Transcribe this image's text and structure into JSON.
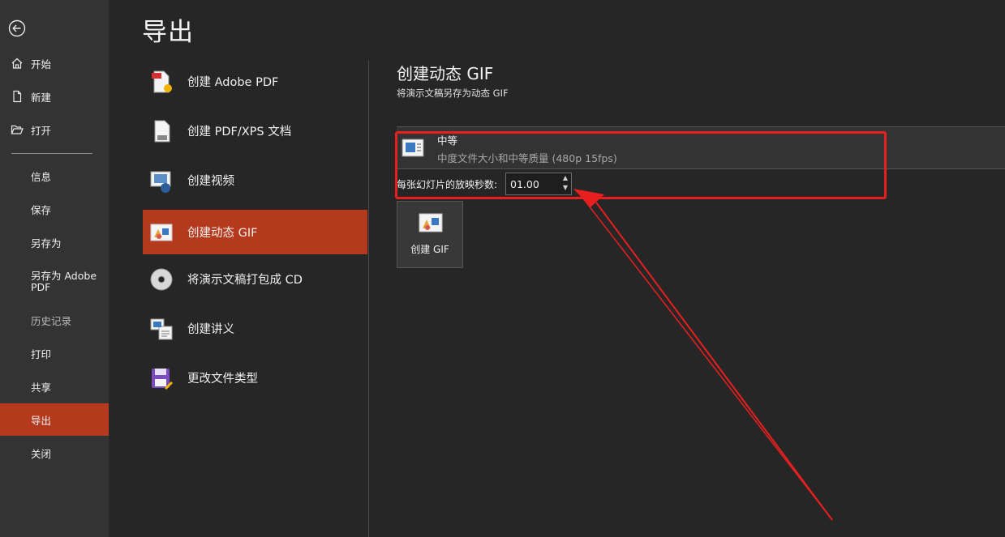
{
  "sidebar": {
    "items": [
      {
        "label": "开始",
        "icon": "home-icon"
      },
      {
        "label": "新建",
        "icon": "new-document-icon"
      },
      {
        "label": "打开",
        "icon": "open-folder-icon"
      },
      {
        "label": "信息"
      },
      {
        "label": "保存"
      },
      {
        "label": "另存为"
      },
      {
        "label": "另存为 Adobe PDF"
      },
      {
        "label": "历史记录"
      },
      {
        "label": "打印"
      },
      {
        "label": "共享"
      },
      {
        "label": "导出"
      },
      {
        "label": "关闭"
      }
    ],
    "active_index": 10
  },
  "page_title": "导出",
  "export_options": [
    {
      "label": "创建 Adobe PDF",
      "icon": "adobe-pdf-icon"
    },
    {
      "label": "创建 PDF/XPS 文档",
      "icon": "pdf-xps-icon"
    },
    {
      "label": "创建视频",
      "icon": "video-icon"
    },
    {
      "label": "创建动态 GIF",
      "icon": "gif-icon"
    },
    {
      "label": "将演示文稿打包成 CD",
      "icon": "cd-icon"
    },
    {
      "label": "创建讲义",
      "icon": "handout-icon"
    },
    {
      "label": "更改文件类型",
      "icon": "file-type-icon"
    }
  ],
  "active_option_index": 3,
  "detail": {
    "title": "创建动态 GIF",
    "subtitle": "将演示文稿另存为动态 GIF",
    "quality": {
      "name": "中等",
      "description": "中度文件大小和中等质量 (480p 15fps)"
    },
    "seconds_label": "每张幻灯片的放映秒数:",
    "seconds_value": "01.00",
    "create_button_label": "创建 GIF"
  },
  "colors": {
    "accent": "#b5391d",
    "annotation": "#e81f1f",
    "background": "#262626",
    "sidebar": "#333333"
  }
}
